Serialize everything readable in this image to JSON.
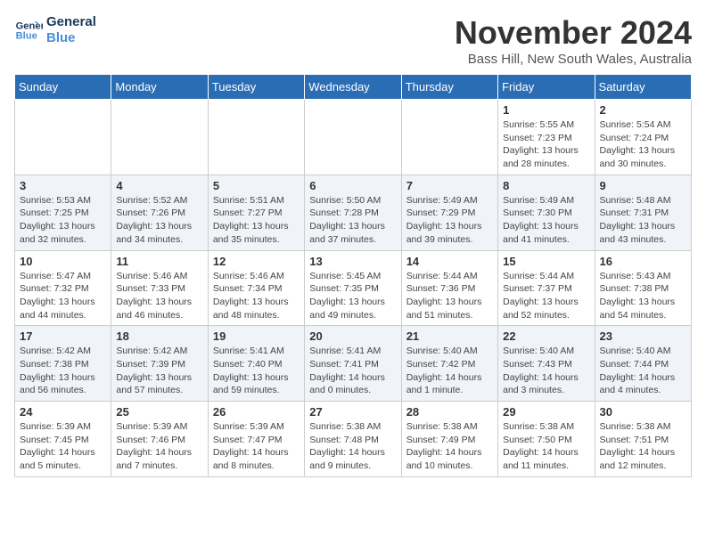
{
  "logo": {
    "line1": "General",
    "line2": "Blue"
  },
  "title": "November 2024",
  "location": "Bass Hill, New South Wales, Australia",
  "days_of_week": [
    "Sunday",
    "Monday",
    "Tuesday",
    "Wednesday",
    "Thursday",
    "Friday",
    "Saturday"
  ],
  "weeks": [
    [
      {
        "day": "",
        "info": ""
      },
      {
        "day": "",
        "info": ""
      },
      {
        "day": "",
        "info": ""
      },
      {
        "day": "",
        "info": ""
      },
      {
        "day": "",
        "info": ""
      },
      {
        "day": "1",
        "info": "Sunrise: 5:55 AM\nSunset: 7:23 PM\nDaylight: 13 hours\nand 28 minutes."
      },
      {
        "day": "2",
        "info": "Sunrise: 5:54 AM\nSunset: 7:24 PM\nDaylight: 13 hours\nand 30 minutes."
      }
    ],
    [
      {
        "day": "3",
        "info": "Sunrise: 5:53 AM\nSunset: 7:25 PM\nDaylight: 13 hours\nand 32 minutes."
      },
      {
        "day": "4",
        "info": "Sunrise: 5:52 AM\nSunset: 7:26 PM\nDaylight: 13 hours\nand 34 minutes."
      },
      {
        "day": "5",
        "info": "Sunrise: 5:51 AM\nSunset: 7:27 PM\nDaylight: 13 hours\nand 35 minutes."
      },
      {
        "day": "6",
        "info": "Sunrise: 5:50 AM\nSunset: 7:28 PM\nDaylight: 13 hours\nand 37 minutes."
      },
      {
        "day": "7",
        "info": "Sunrise: 5:49 AM\nSunset: 7:29 PM\nDaylight: 13 hours\nand 39 minutes."
      },
      {
        "day": "8",
        "info": "Sunrise: 5:49 AM\nSunset: 7:30 PM\nDaylight: 13 hours\nand 41 minutes."
      },
      {
        "day": "9",
        "info": "Sunrise: 5:48 AM\nSunset: 7:31 PM\nDaylight: 13 hours\nand 43 minutes."
      }
    ],
    [
      {
        "day": "10",
        "info": "Sunrise: 5:47 AM\nSunset: 7:32 PM\nDaylight: 13 hours\nand 44 minutes."
      },
      {
        "day": "11",
        "info": "Sunrise: 5:46 AM\nSunset: 7:33 PM\nDaylight: 13 hours\nand 46 minutes."
      },
      {
        "day": "12",
        "info": "Sunrise: 5:46 AM\nSunset: 7:34 PM\nDaylight: 13 hours\nand 48 minutes."
      },
      {
        "day": "13",
        "info": "Sunrise: 5:45 AM\nSunset: 7:35 PM\nDaylight: 13 hours\nand 49 minutes."
      },
      {
        "day": "14",
        "info": "Sunrise: 5:44 AM\nSunset: 7:36 PM\nDaylight: 13 hours\nand 51 minutes."
      },
      {
        "day": "15",
        "info": "Sunrise: 5:44 AM\nSunset: 7:37 PM\nDaylight: 13 hours\nand 52 minutes."
      },
      {
        "day": "16",
        "info": "Sunrise: 5:43 AM\nSunset: 7:38 PM\nDaylight: 13 hours\nand 54 minutes."
      }
    ],
    [
      {
        "day": "17",
        "info": "Sunrise: 5:42 AM\nSunset: 7:38 PM\nDaylight: 13 hours\nand 56 minutes."
      },
      {
        "day": "18",
        "info": "Sunrise: 5:42 AM\nSunset: 7:39 PM\nDaylight: 13 hours\nand 57 minutes."
      },
      {
        "day": "19",
        "info": "Sunrise: 5:41 AM\nSunset: 7:40 PM\nDaylight: 13 hours\nand 59 minutes."
      },
      {
        "day": "20",
        "info": "Sunrise: 5:41 AM\nSunset: 7:41 PM\nDaylight: 14 hours\nand 0 minutes."
      },
      {
        "day": "21",
        "info": "Sunrise: 5:40 AM\nSunset: 7:42 PM\nDaylight: 14 hours\nand 1 minute."
      },
      {
        "day": "22",
        "info": "Sunrise: 5:40 AM\nSunset: 7:43 PM\nDaylight: 14 hours\nand 3 minutes."
      },
      {
        "day": "23",
        "info": "Sunrise: 5:40 AM\nSunset: 7:44 PM\nDaylight: 14 hours\nand 4 minutes."
      }
    ],
    [
      {
        "day": "24",
        "info": "Sunrise: 5:39 AM\nSunset: 7:45 PM\nDaylight: 14 hours\nand 5 minutes."
      },
      {
        "day": "25",
        "info": "Sunrise: 5:39 AM\nSunset: 7:46 PM\nDaylight: 14 hours\nand 7 minutes."
      },
      {
        "day": "26",
        "info": "Sunrise: 5:39 AM\nSunset: 7:47 PM\nDaylight: 14 hours\nand 8 minutes."
      },
      {
        "day": "27",
        "info": "Sunrise: 5:38 AM\nSunset: 7:48 PM\nDaylight: 14 hours\nand 9 minutes."
      },
      {
        "day": "28",
        "info": "Sunrise: 5:38 AM\nSunset: 7:49 PM\nDaylight: 14 hours\nand 10 minutes."
      },
      {
        "day": "29",
        "info": "Sunrise: 5:38 AM\nSunset: 7:50 PM\nDaylight: 14 hours\nand 11 minutes."
      },
      {
        "day": "30",
        "info": "Sunrise: 5:38 AM\nSunset: 7:51 PM\nDaylight: 14 hours\nand 12 minutes."
      }
    ]
  ]
}
